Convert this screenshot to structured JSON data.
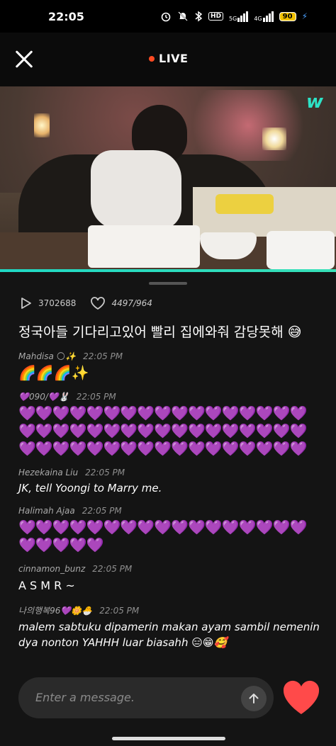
{
  "status_bar": {
    "time": "22:05",
    "icons": [
      "alarm-icon",
      "mute-icon",
      "bluetooth-icon",
      "hd-icon",
      "5g-signal-icon",
      "4g-signal-icon"
    ],
    "hd_label": "HD",
    "net1": "5G",
    "net2": "4G",
    "battery": "90"
  },
  "header": {
    "close_icon": "close-icon",
    "live_label": "LIVE",
    "live_color": "#ff4a22"
  },
  "video": {
    "brand_icon": "weverse-icon",
    "brand_glyph": "w",
    "progress_color": "#1fd8c4"
  },
  "stats": {
    "views": "3702688",
    "likes": "4497/964"
  },
  "notice": "정국아들 기다리고있어 빨리 집에와줘 감당못해 😅",
  "messages": [
    {
      "name": "Mahdisa 🌕✨",
      "time": "22:05 PM",
      "text": "🌈🌈🌈✨"
    },
    {
      "name": "💜090/💜🐰",
      "time": "22:05 PM",
      "text": "💜💜💜💜💜💜💜💜💜💜💜💜💜💜💜💜💜💜💜💜💜💜💜💜💜💜💜💜💜💜💜💜💜💜💜💜💜💜💜💜💜💜💜💜💜💜💜💜💜💜💜"
    },
    {
      "name": "Hezekaina Liu",
      "time": "22:05 PM",
      "text": "JK, tell Yoongi to Marry me."
    },
    {
      "name": "Halimah Ajaa",
      "time": "22:05 PM",
      "text": "💜💜💜💜💜💜💜💜💜💜💜💜💜💜💜💜💜💜💜💜💜💜"
    },
    {
      "name": "cinnamon_bunz",
      "time": "22:05 PM",
      "text": "A S M R ~"
    },
    {
      "name": "나의행복96💜🌼🐣",
      "time": "22:05 PM",
      "text": "malem sabtuku dipamerin makan ayam sambil nemenin dya nonton YAHHH luar biasahh 😑😁🥰"
    }
  ],
  "composer": {
    "placeholder": "Enter a message.",
    "send_icon": "arrow-up-icon",
    "heart_icon": "heart-icon",
    "heart_color": "#ff4a4a"
  }
}
